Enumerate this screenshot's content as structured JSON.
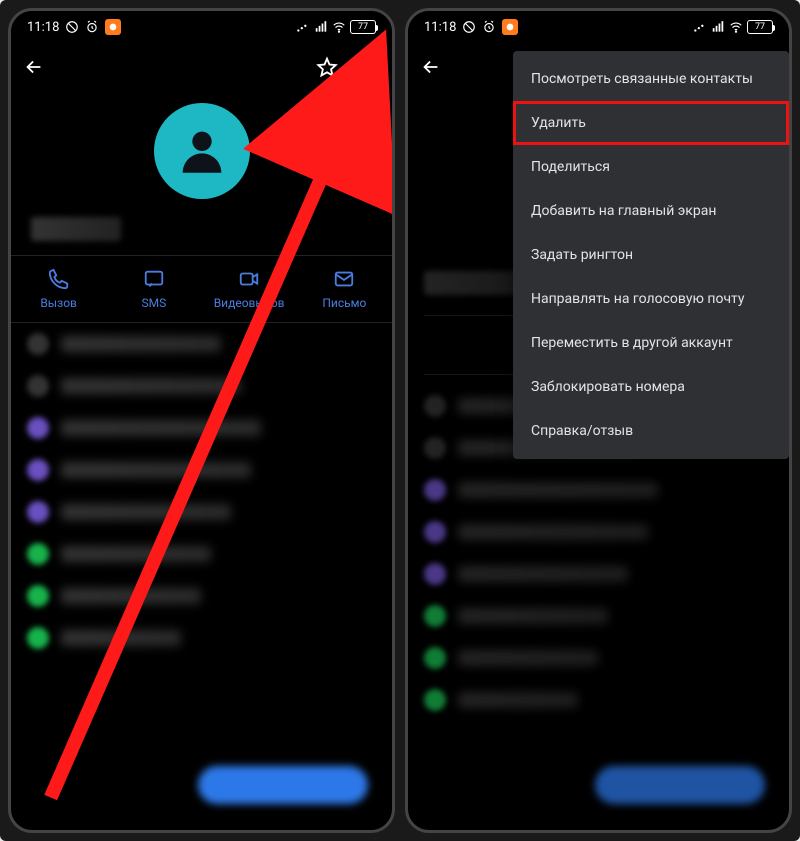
{
  "status": {
    "time": "11:18",
    "battery": "77"
  },
  "actions": {
    "call": "Вызов",
    "sms": "SMS",
    "video": "Видеовызов",
    "email": "Письмо"
  },
  "menu": {
    "view_linked": "Посмотреть связанные контакты",
    "delete": "Удалить",
    "share": "Поделиться",
    "add_home": "Добавить на главный экран",
    "set_ringtone": "Задать рингтон",
    "route_voicemail": "Направлять на голосовую почту",
    "move_account": "Переместить в другой аккаунт",
    "block": "Заблокировать номера",
    "help": "Справка/отзыв"
  }
}
